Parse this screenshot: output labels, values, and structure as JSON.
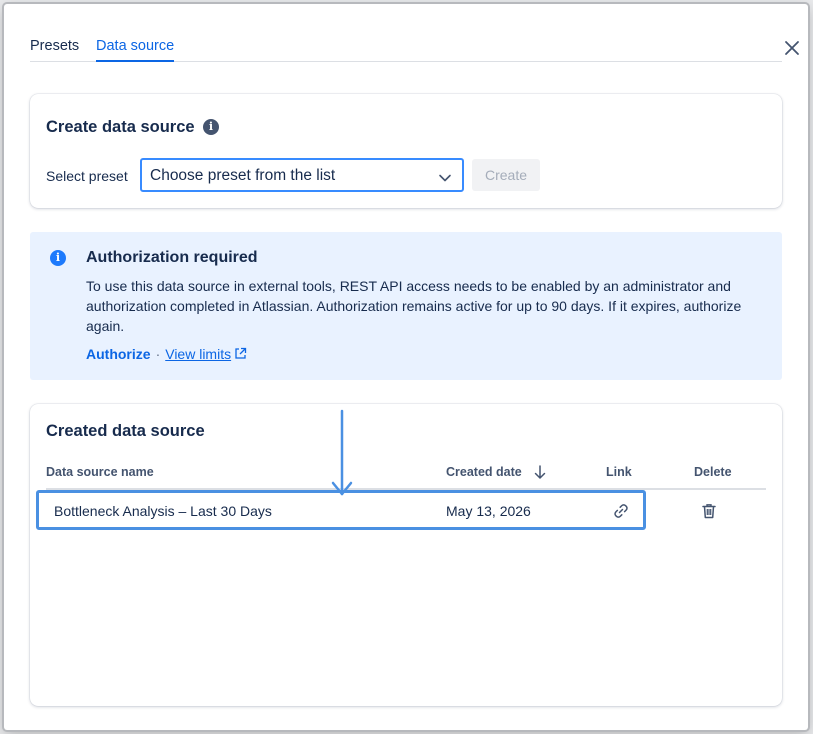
{
  "tabs": [
    {
      "label": "Presets",
      "active": false
    },
    {
      "label": "Data source",
      "active": true
    }
  ],
  "create_card": {
    "title": "Create data source",
    "select_label": "Select preset",
    "select_value": "Choose preset from the list",
    "create_button": "Create"
  },
  "auth": {
    "title": "Authorization required",
    "body": "To use this data source in external tools, REST API access needs to be enabled by an administrator and authorization completed in Atlassian. Authorization remains active for up to 90 days. If it expires, authorize again.",
    "authorize_link": "Authorize",
    "separator": "·",
    "limits_link": "View limits"
  },
  "created_card": {
    "title": "Created data source",
    "columns": {
      "name": "Data source name",
      "date": "Created date",
      "link": "Link",
      "delete": "Delete"
    },
    "rows": [
      {
        "name": "Bottleneck Analysis – Last 30 Days",
        "date": "May 13, 2026"
      }
    ]
  },
  "icons": {
    "close": "close-icon",
    "info": "info-icon",
    "chevron": "chevron-down-icon",
    "external": "external-link-icon",
    "sort": "arrow-down-icon",
    "link": "link-icon",
    "delete": "trash-icon"
  },
  "colors": {
    "accent": "#0c66e4",
    "info_background": "#e9f2ff",
    "highlight": "#4a90e2"
  }
}
